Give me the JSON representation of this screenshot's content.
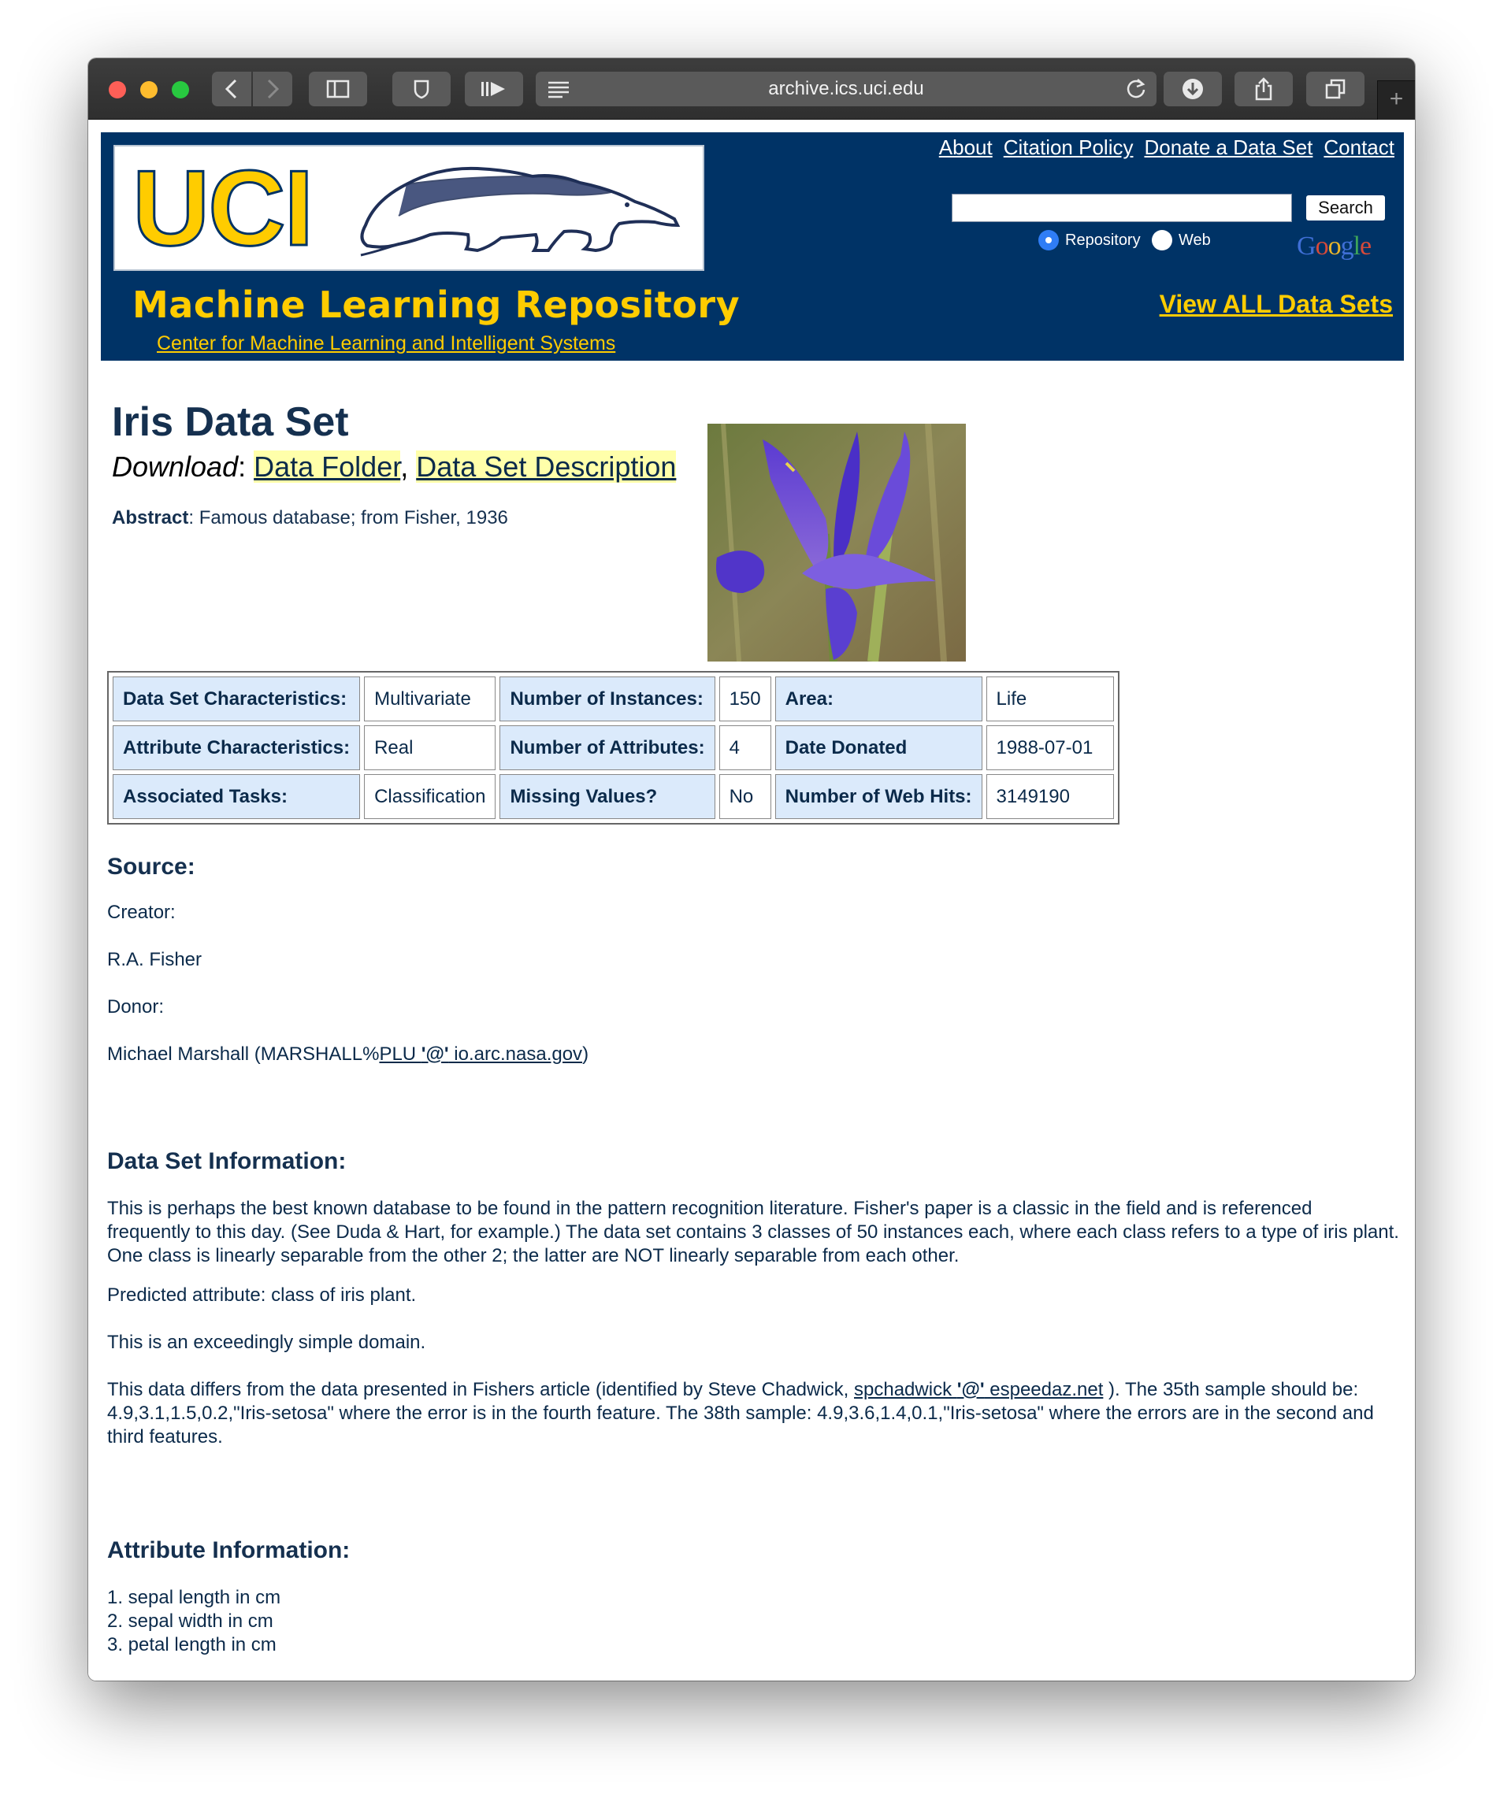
{
  "browser": {
    "url": "archive.ics.uci.edu",
    "icons": [
      "back-icon",
      "forward-icon",
      "sidebar-icon",
      "shield-icon",
      "play-icon",
      "reader-icon",
      "reload-icon",
      "download-icon",
      "share-icon",
      "tabs-icon",
      "new-tab-icon"
    ]
  },
  "header": {
    "logo_text": "UCI",
    "title": "Machine Learning Repository",
    "subtitle": "Center for Machine Learning and Intelligent Systems",
    "links": [
      "About",
      "Citation Policy",
      "Donate a Data Set",
      "Contact"
    ],
    "search_button": "Search",
    "radio_repository": "Repository",
    "radio_web": "Web",
    "google": "Google",
    "view_all": "View ALL Data Sets",
    "colors": {
      "banner": "#003366",
      "accent": "#ffcc00"
    }
  },
  "dataset": {
    "title": "Iris Data Set",
    "download_label": "Download",
    "download_links": [
      "Data Folder",
      "Data Set Description"
    ],
    "abstract_label": "Abstract",
    "abstract_text": ": Famous database; from Fisher, 1936"
  },
  "table": [
    [
      "Data Set Characteristics:",
      "Multivariate",
      "Number of Instances:",
      "150",
      "Area:",
      "Life"
    ],
    [
      "Attribute Characteristics:",
      "Real",
      "Number of Attributes:",
      "4",
      "Date Donated",
      "1988-07-01"
    ],
    [
      "Associated Tasks:",
      "Classification",
      "Missing Values?",
      "No",
      "Number of Web Hits:",
      "3149190"
    ]
  ],
  "source": {
    "heading": "Source:",
    "creator_label": "Creator:",
    "creator": "R.A. Fisher",
    "donor_label": "Donor:",
    "donor_prefix": "Michael Marshall (MARSHALL%",
    "donor_link_a": "PLU ",
    "donor_link_at": "'@'",
    "donor_link_b": " io.arc.nasa.gov",
    "donor_suffix": ")"
  },
  "info": {
    "heading": "Data Set Information:",
    "p1": "This is perhaps the best known database to be found in the pattern recognition literature. Fisher's paper is a classic in the field and is referenced frequently to this day. (See Duda & Hart, for example.) The data set contains 3 classes of 50 instances each, where each class refers to a type of iris plant. One class is linearly separable from the other 2; the latter are NOT linearly separable from each other.",
    "p2": "Predicted attribute: class of iris plant.",
    "p3": "This is an exceedingly simple domain.",
    "p4_a": "This data differs from the data presented in Fishers article (identified by Steve Chadwick, ",
    "p4_link_a": "spchadwick ",
    "p4_link_at": "'@'",
    "p4_link_b": " espeedaz.net",
    "p4_b": " ). The 35th sample should be: 4.9,3.1,1.5,0.2,\"Iris-setosa\" where the error is in the fourth feature. The 38th sample: 4.9,3.6,1.4,0.1,\"Iris-setosa\" where the errors are in the second and third features."
  },
  "attributes": {
    "heading": "Attribute Information:",
    "items": [
      "1. sepal length in cm",
      "2. sepal width in cm",
      "3. petal length in cm"
    ]
  }
}
